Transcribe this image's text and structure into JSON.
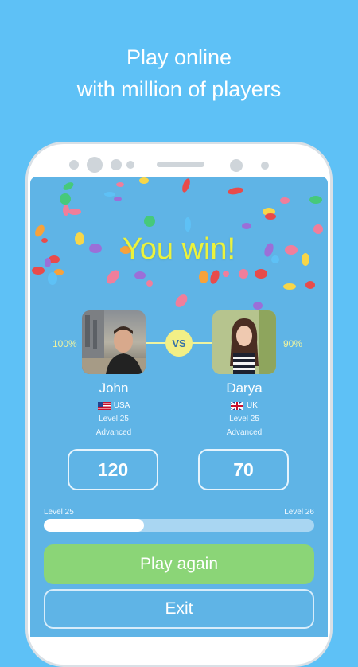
{
  "headline": {
    "line1": "Play online",
    "line2": "with million of players"
  },
  "result": {
    "title": "You win!"
  },
  "versus_label": "VS",
  "players": [
    {
      "name": "John",
      "country": "USA",
      "level": "Level 25",
      "rank": "Advanced",
      "percent": "100%",
      "score": "120"
    },
    {
      "name": "Darya",
      "country": "UK",
      "level": "Level 25",
      "rank": "Advanced",
      "percent": "90%",
      "score": "70"
    }
  ],
  "progress": {
    "from_label": "Level 25",
    "to_label": "Level 26",
    "value": 0.37
  },
  "buttons": {
    "play_again": "Play again",
    "exit": "Exit"
  },
  "colors": {
    "background": "#5ec1f6",
    "screen": "#5fb4e6",
    "win_text": "#ecf23c",
    "play_button": "#8bd577"
  }
}
